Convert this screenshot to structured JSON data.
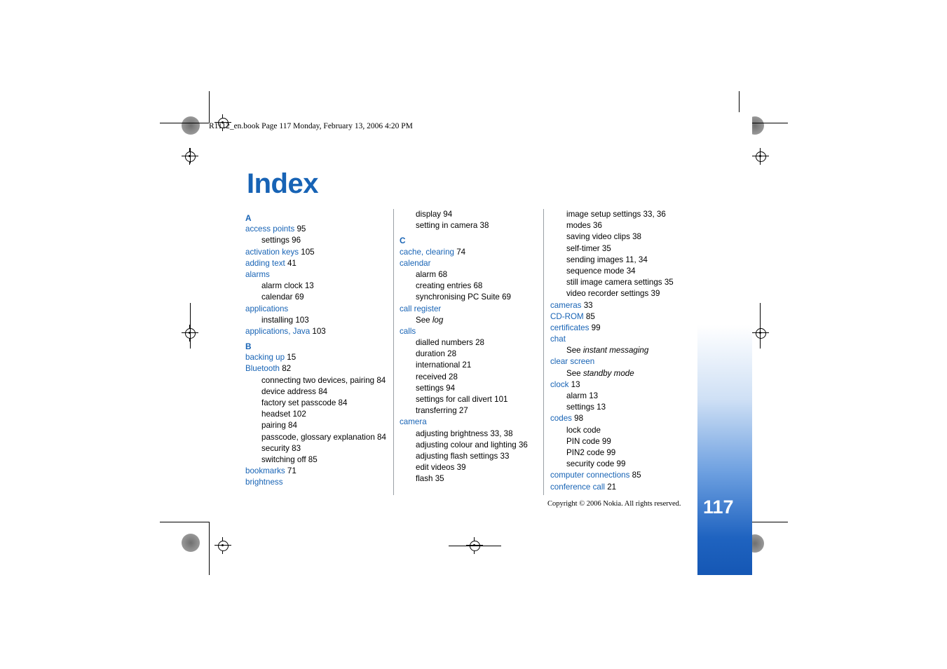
{
  "page": {
    "header_line": "R1112_en.book  Page 117  Monday, February 13, 2006  4:20 PM",
    "title": "Index",
    "copyright": "Copyright © 2006 Nokia. All rights reserved.",
    "folio": "117"
  },
  "columns": [
    {
      "id": "column-1",
      "blocks": [
        {
          "type": "letter",
          "text": "A"
        },
        {
          "type": "entry",
          "term": "access points",
          "page": "95"
        },
        {
          "type": "sub",
          "text": "settings 96"
        },
        {
          "type": "entry",
          "term": "activation keys",
          "page": "105"
        },
        {
          "type": "entry",
          "term": "adding text",
          "page": "41"
        },
        {
          "type": "entry",
          "term": "alarms",
          "page": ""
        },
        {
          "type": "sub",
          "text": "alarm clock 13"
        },
        {
          "type": "sub",
          "text": "calendar 69"
        },
        {
          "type": "entry",
          "term": "applications",
          "page": ""
        },
        {
          "type": "sub",
          "text": "installing 103"
        },
        {
          "type": "entry",
          "term": "applications, Java",
          "page": "103"
        },
        {
          "type": "letter",
          "text": "B"
        },
        {
          "type": "entry",
          "term": "backing up",
          "page": "15"
        },
        {
          "type": "entry",
          "term": "Bluetooth",
          "page": "82"
        },
        {
          "type": "sub",
          "text": "connecting two devices, pairing 84"
        },
        {
          "type": "sub",
          "text": "device address 84"
        },
        {
          "type": "sub",
          "text": "factory set passcode 84"
        },
        {
          "type": "sub",
          "text": "headset 102"
        },
        {
          "type": "sub",
          "text": "pairing 84"
        },
        {
          "type": "sub",
          "text": "passcode, glossary explanation 84"
        },
        {
          "type": "sub",
          "text": "security 83"
        },
        {
          "type": "sub",
          "text": "switching off 85"
        },
        {
          "type": "entry",
          "term": "bookmarks",
          "page": "71"
        },
        {
          "type": "entry",
          "term": "brightness",
          "page": ""
        }
      ]
    },
    {
      "id": "column-2",
      "blocks": [
        {
          "type": "sub",
          "text": "display 94"
        },
        {
          "type": "sub",
          "text": "setting in camera 38"
        },
        {
          "type": "letter",
          "text": "C"
        },
        {
          "type": "entry",
          "term": "cache, clearing",
          "page": "74"
        },
        {
          "type": "entry",
          "term": "calendar",
          "page": ""
        },
        {
          "type": "sub",
          "text": "alarm 68"
        },
        {
          "type": "sub",
          "text": "creating entries 68"
        },
        {
          "type": "sub",
          "text": "synchronising PC Suite 69"
        },
        {
          "type": "entry",
          "term": "call register",
          "page": ""
        },
        {
          "type": "sub",
          "text": "See ",
          "italic": "log"
        },
        {
          "type": "entry",
          "term": "calls",
          "page": ""
        },
        {
          "type": "sub",
          "text": "dialled numbers 28"
        },
        {
          "type": "sub",
          "text": "duration 28"
        },
        {
          "type": "sub",
          "text": "international 21"
        },
        {
          "type": "sub",
          "text": "received 28"
        },
        {
          "type": "sub",
          "text": "settings 94"
        },
        {
          "type": "sub",
          "text": "settings for call divert 101"
        },
        {
          "type": "sub",
          "text": "transferring 27"
        },
        {
          "type": "entry",
          "term": "camera",
          "page": ""
        },
        {
          "type": "sub",
          "text": "adjusting brightness 33, 38"
        },
        {
          "type": "sub",
          "text": "adjusting colour and lighting 36"
        },
        {
          "type": "sub",
          "text": "adjusting flash settings 33"
        },
        {
          "type": "sub",
          "text": "edit videos 39"
        },
        {
          "type": "sub",
          "text": "flash 35"
        }
      ]
    },
    {
      "id": "column-3",
      "blocks": [
        {
          "type": "sub",
          "text": "image setup settings 33, 36"
        },
        {
          "type": "sub",
          "text": "modes 36"
        },
        {
          "type": "sub",
          "text": "saving video clips 38"
        },
        {
          "type": "sub",
          "text": "self-timer 35"
        },
        {
          "type": "sub",
          "text": "sending images 11, 34"
        },
        {
          "type": "sub",
          "text": "sequence mode 34"
        },
        {
          "type": "sub",
          "text": "still image camera settings 35"
        },
        {
          "type": "sub",
          "text": "video recorder settings 39"
        },
        {
          "type": "entry",
          "term": "cameras",
          "page": "33"
        },
        {
          "type": "entry",
          "term": "CD-ROM",
          "page": "85"
        },
        {
          "type": "entry",
          "term": "certificates",
          "page": "99"
        },
        {
          "type": "entry",
          "term": "chat",
          "page": ""
        },
        {
          "type": "sub",
          "text": "See ",
          "italic": "instant messaging"
        },
        {
          "type": "entry",
          "term": "clear screen",
          "page": ""
        },
        {
          "type": "sub",
          "text": "See ",
          "italic": "standby mode"
        },
        {
          "type": "entry",
          "term": "clock",
          "page": "13"
        },
        {
          "type": "sub",
          "text": "alarm 13"
        },
        {
          "type": "sub",
          "text": "settings 13"
        },
        {
          "type": "entry",
          "term": "codes",
          "page": "98"
        },
        {
          "type": "sub",
          "text": "lock code"
        },
        {
          "type": "sub",
          "text": "PIN code 99"
        },
        {
          "type": "sub",
          "text": "PIN2 code 99"
        },
        {
          "type": "sub",
          "text": "security code 99"
        },
        {
          "type": "entry",
          "term": "computer connections",
          "page": "85"
        },
        {
          "type": "entry",
          "term": "conference call",
          "page": "21"
        }
      ]
    }
  ],
  "colors": {
    "link_blue": "#1763b5",
    "tab_blue": "#1557b4"
  }
}
